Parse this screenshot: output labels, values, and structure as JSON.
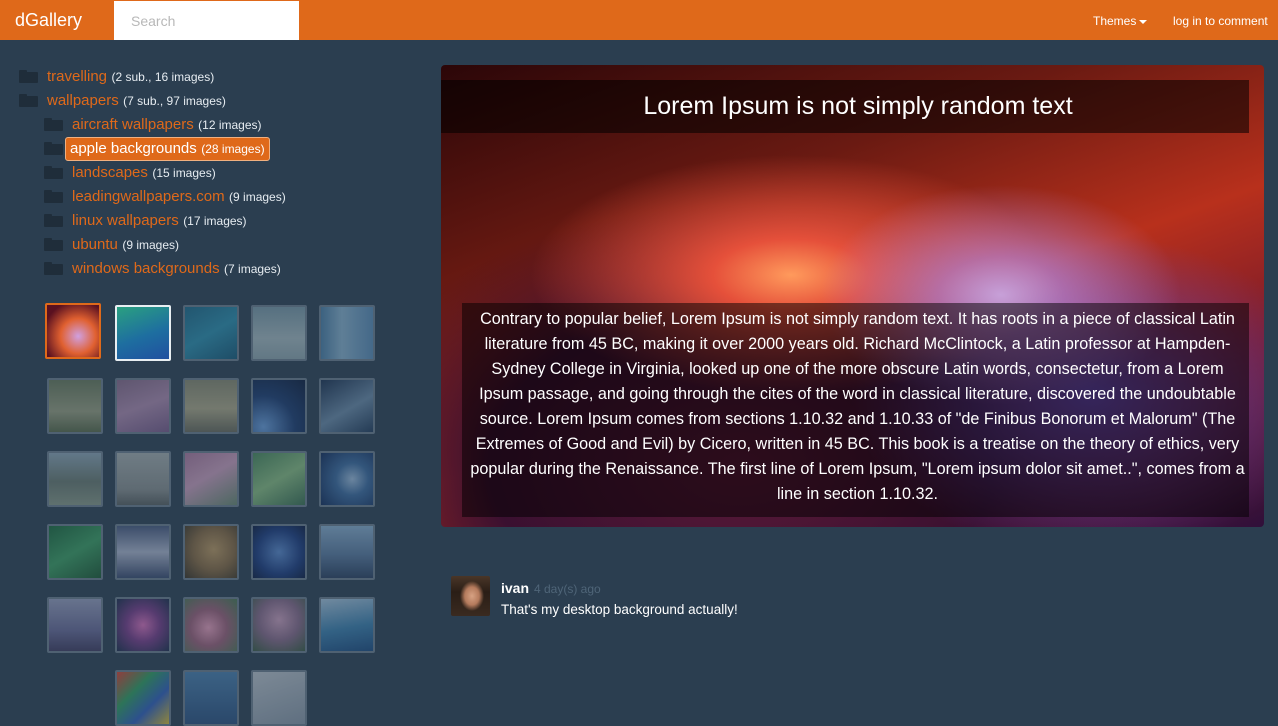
{
  "app": {
    "brand": "dGallery",
    "search_placeholder": "Search",
    "themes_label": "Themes",
    "login_label": "log in to comment"
  },
  "tree": [
    {
      "name": "travelling",
      "count": "(2 sub., 16 images)"
    },
    {
      "name": "wallpapers",
      "count": "(7 sub., 97 images)"
    },
    {
      "name": "aircraft wallpapers",
      "count": "(12 images)"
    },
    {
      "name": "apple backgrounds",
      "count": "(28 images)"
    },
    {
      "name": "landscapes",
      "count": "(15 images)"
    },
    {
      "name": "leadingwallpapers.com",
      "count": "(9 images)"
    },
    {
      "name": "linux wallpapers",
      "count": "(17 images)"
    },
    {
      "name": "ubuntu",
      "count": "(9 images)"
    },
    {
      "name": "windows backgrounds",
      "count": "(7 images)"
    }
  ],
  "image": {
    "title": "Lorem Ipsum is not simply random text",
    "description": "Contrary to popular belief, Lorem Ipsum is not simply random text. It has roots in a piece of classical Latin literature from 45 BC, making it over 2000 years old. Richard McClintock, a Latin professor at Hampden-Sydney College in Virginia, looked up one of the more obscure Latin words, consectetur, from a Lorem Ipsum passage, and going through the cites of the word in classical literature, discovered the undoubtable source. Lorem Ipsum comes from sections 1.10.32 and 1.10.33 of \"de Finibus Bonorum et Malorum\" (The Extremes of Good and Evil) by Cicero, written in 45 BC. This book is a treatise on the theory of ethics, very popular during the Renaissance. The first line of Lorem Ipsum, \"Lorem ipsum dolor sit amet..\", comes from a line in section 1.10.32."
  },
  "comment": {
    "author": "ivan",
    "time": "4 day(s) ago",
    "text": "That's my desktop background actually!"
  },
  "colors": {
    "accent": "#df691a",
    "background": "#2b3e50",
    "folder": "#1f2d3a"
  }
}
